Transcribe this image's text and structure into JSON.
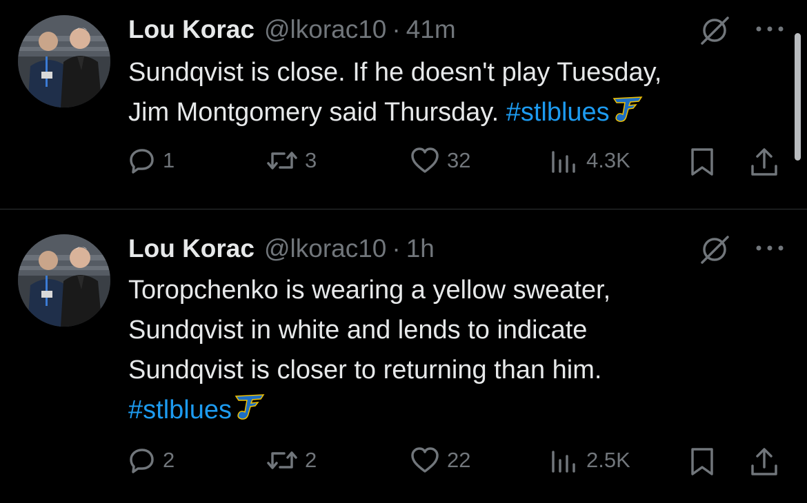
{
  "colors": {
    "background": "#000000",
    "text": "#e7e9ea",
    "muted": "#71767b",
    "hashtag": "#1d9bf0",
    "divider": "#2f3336"
  },
  "tweets": [
    {
      "author": "Lou Korac",
      "handle": "@lkorac10",
      "separator": "·",
      "time": "41m",
      "text_lines": [
        "Sundqvist is close. If he doesn't play Tuesday,",
        "Jim Montgomery said Thursday."
      ],
      "hashtag": "#stlblues",
      "hashtag_icon": "blues-note-logo-icon",
      "reply_count": "1",
      "retweet_count": "3",
      "like_count": "32",
      "view_count": "4.3K"
    },
    {
      "author": "Lou Korac",
      "handle": "@lkorac10",
      "separator": "·",
      "time": "1h",
      "text_lines": [
        "Toropchenko is wearing a yellow sweater,",
        "Sundqvist in white and lends to indicate",
        "Sundqvist is closer to returning than him."
      ],
      "hashtag": "#stlblues",
      "hashtag_icon": "blues-note-logo-icon",
      "reply_count": "2",
      "retweet_count": "2",
      "like_count": "22",
      "view_count": "2.5K"
    }
  ],
  "icons": [
    "grok-icon",
    "more-icon",
    "reply-icon",
    "retweet-icon",
    "like-icon",
    "views-icon",
    "bookmark-icon",
    "share-icon"
  ]
}
